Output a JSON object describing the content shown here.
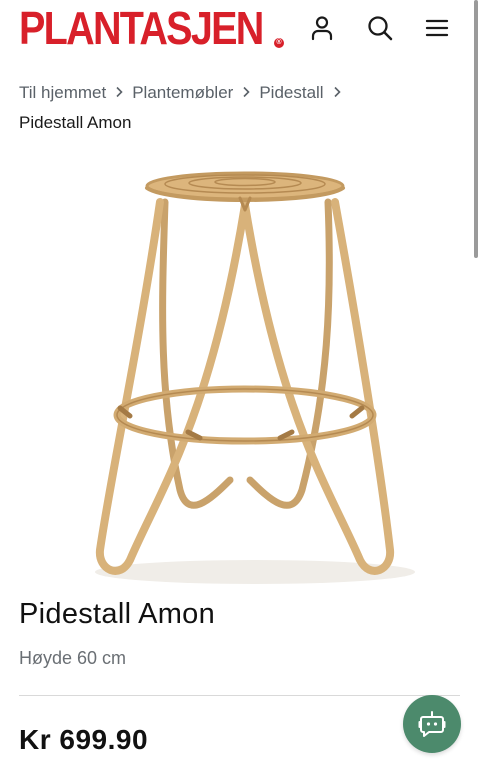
{
  "header": {
    "logo_text": "PLANTASJEN",
    "logo_mark": "®",
    "icons": [
      "user-icon",
      "search-icon",
      "menu-icon"
    ]
  },
  "breadcrumb": {
    "items": [
      "Til hjemmet",
      "Plantemøbler",
      "Pidestall"
    ],
    "current": "Pidestall Amon",
    "separator_icon": "chevron-right-icon"
  },
  "product": {
    "title": "Pidestall Amon",
    "subtitle": "Høyde 60 cm",
    "price": "Kr 699.90",
    "image_icon": "rattan-stool-image"
  },
  "chat": {
    "icon": "chat-bot-icon"
  },
  "colors": {
    "brand_red": "#d8202a",
    "chat_green": "#4c8a6c",
    "text_dark": "#111111",
    "text_muted": "#6a6f74"
  }
}
